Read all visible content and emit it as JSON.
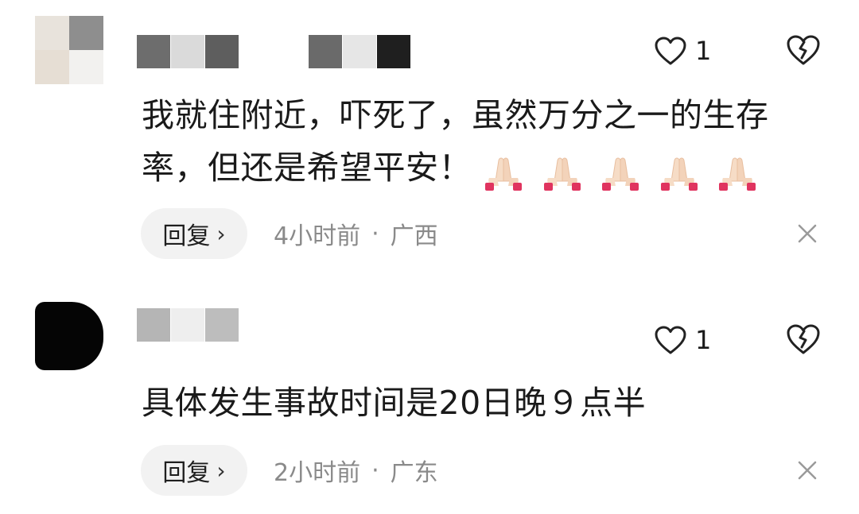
{
  "comments": [
    {
      "text_line1": "我就住附近，吓死了，虽然万分之一的生存",
      "text_line2": "率，但还是希望平安！",
      "emoji_icon": "folded-hands-emoji",
      "emoji_count": 5,
      "like_count": "1",
      "reply_label": "回复",
      "reply_chevron": "›",
      "time": "4小时前",
      "separator": "·",
      "location": "广西"
    },
    {
      "text_line1": "具体发生事故时间是20日晚９点半",
      "like_count": "1",
      "reply_label": "回复",
      "reply_chevron": "›",
      "time": "2小时前",
      "separator": "·",
      "location": "广东"
    }
  ],
  "icons": {
    "like": "heart-outline-icon",
    "dislike": "broken-heart-icon",
    "close": "close-x-icon"
  },
  "colors": {
    "text": "#1a1a1a",
    "meta": "#8a8a8a",
    "reply_bg": "#f2f2f2",
    "icon": "#222222",
    "close": "#9a9a9a"
  }
}
